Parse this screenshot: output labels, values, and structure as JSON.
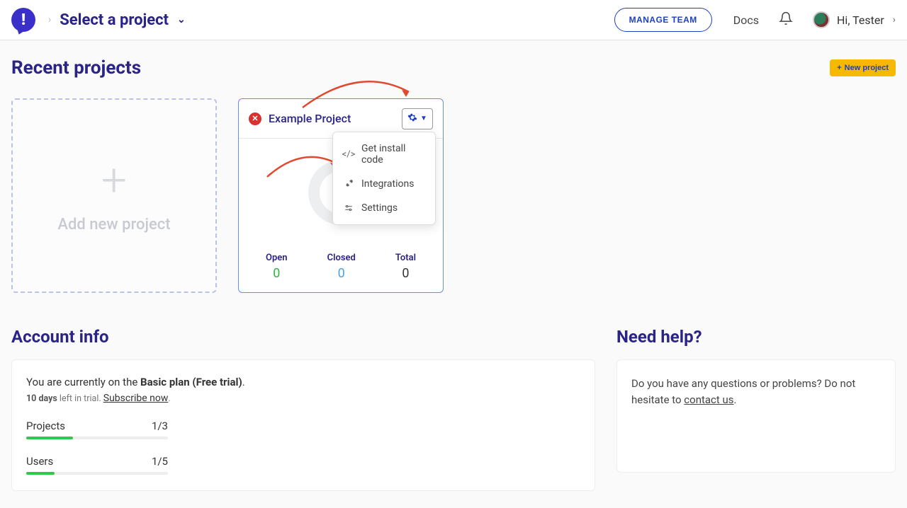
{
  "header": {
    "project_selector": "Select a project",
    "manage_team": "MANAGE TEAM",
    "docs": "Docs",
    "greeting": "Hi, Tester"
  },
  "recent": {
    "title": "Recent projects",
    "new_project": "New project",
    "add_new": "Add new project"
  },
  "project_card": {
    "name": "Example Project",
    "stats": {
      "open_label": "Open",
      "open_value": "0",
      "closed_label": "Closed",
      "closed_value": "0",
      "total_label": "Total",
      "total_value": "0"
    },
    "menu": {
      "install": "Get install code",
      "integrations": "Integrations",
      "settings": "Settings"
    }
  },
  "account": {
    "title": "Account info",
    "plan_prefix": "You are currently on the ",
    "plan_name": "Basic plan (Free trial)",
    "plan_suffix": ".",
    "trial_days": "10 days",
    "trial_text": " left in trial. ",
    "subscribe": "Subscribe now",
    "projects_label": "Projects",
    "projects_value": "1/3",
    "projects_pct": 33,
    "users_label": "Users",
    "users_value": "1/5",
    "users_pct": 20
  },
  "help": {
    "title": "Need help?",
    "text_1": "Do you have any questions or problems? Do not hesitate to ",
    "contact": "contact us",
    "text_2": "."
  }
}
